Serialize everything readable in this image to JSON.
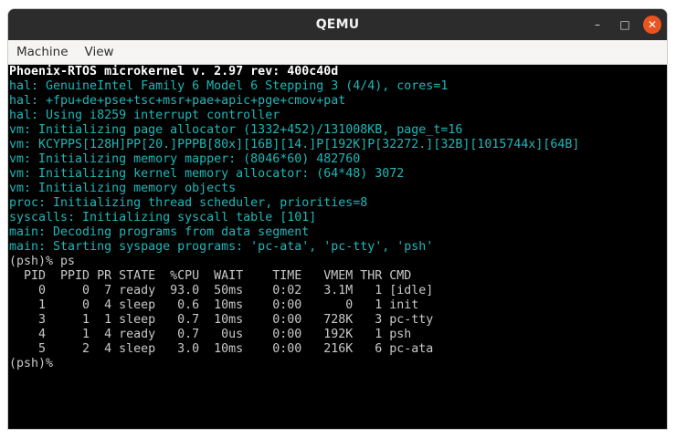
{
  "window": {
    "title": "QEMU",
    "controls": {
      "minimize": "–",
      "maximize": "□",
      "close": "✕"
    }
  },
  "menu": [
    "Machine",
    "View"
  ],
  "terminal": {
    "lines": [
      {
        "text": "Phoenix-RTOS microkernel v. 2.97 rev: 400c40d",
        "color": "white"
      },
      {
        "text": "hal: GenuineIntel Family 6 Model 6 Stepping 3 (4/4), cores=1",
        "color": "cyan"
      },
      {
        "text": "hal: +fpu+de+pse+tsc+msr+pae+apic+pge+cmov+pat",
        "color": "cyan"
      },
      {
        "text": "hal: Using i8259 interrupt controller",
        "color": "cyan"
      },
      {
        "text": "vm: Initializing page allocator (1332+452)/131008KB, page_t=16",
        "color": "cyan"
      },
      {
        "text": "vm: KCYPPS[128H]PP[20.]PPPB[80x][16B][14.]P[192K]P[32272.][32B][1015744x][64B]",
        "color": "cyan"
      },
      {
        "text": "vm: Initializing memory mapper: (8046*60) 482760",
        "color": "cyan"
      },
      {
        "text": "vm: Initializing kernel memory allocator: (64*48) 3072",
        "color": "cyan"
      },
      {
        "text": "vm: Initializing memory objects",
        "color": "cyan"
      },
      {
        "text": "proc: Initializing thread scheduler, priorities=8",
        "color": "cyan"
      },
      {
        "text": "syscalls: Initializing syscall table [101]",
        "color": "cyan"
      },
      {
        "text": "main: Decoding programs from data segment",
        "color": "cyan"
      },
      {
        "text": "main: Starting syspage programs: 'pc-ata', 'pc-tty', 'psh'",
        "color": "cyan"
      },
      {
        "text": "(psh)% ps",
        "color": "gray"
      },
      {
        "text": "  PID  PPID PR STATE  %CPU  WAIT    TIME   VMEM THR CMD",
        "color": "gray"
      },
      {
        "text": "    0     0  7 ready  93.0  50ms    0:02   3.1M   1 [idle]",
        "color": "gray"
      },
      {
        "text": "    1     0  4 sleep   0.6  10ms    0:00      0   1 init",
        "color": "gray"
      },
      {
        "text": "    3     1  1 sleep   0.7  10ms    0:00   728K   3 pc-tty",
        "color": "gray"
      },
      {
        "text": "    4     1  4 ready   0.7   0us    0:00   192K   1 psh",
        "color": "gray"
      },
      {
        "text": "    5     2  4 sleep   3.0  10ms    0:00   216K   6 pc-ata",
        "color": "gray"
      },
      {
        "text": "(psh)%",
        "color": "gray"
      }
    ]
  }
}
